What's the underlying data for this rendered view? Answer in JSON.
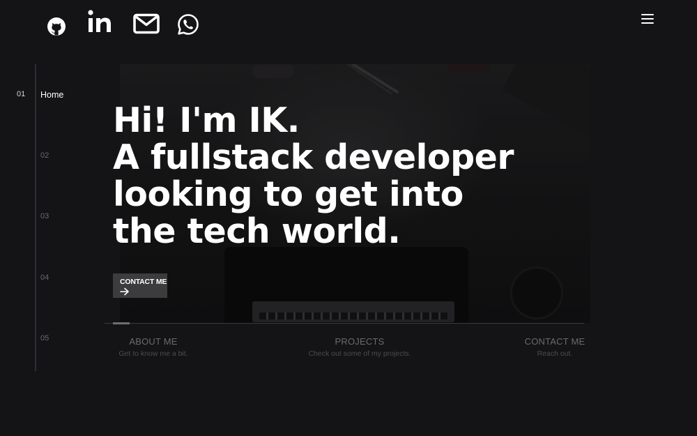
{
  "socials": [
    {
      "name": "github",
      "icon": "github-icon"
    },
    {
      "name": "linkedin",
      "icon": "linkedin-icon",
      "text": "in"
    },
    {
      "name": "email",
      "icon": "mail-icon"
    },
    {
      "name": "whatsapp",
      "icon": "whatsapp-icon"
    }
  ],
  "menu": {
    "icon": "hamburger-menu-icon"
  },
  "side_nav": {
    "items": [
      {
        "number": "01",
        "label": "Home",
        "active": true
      },
      {
        "number": "02",
        "active": false
      },
      {
        "number": "03",
        "active": false
      },
      {
        "number": "04",
        "active": false
      },
      {
        "number": "05",
        "active": false
      }
    ]
  },
  "hero": {
    "lines": [
      "Hi! I'm IK.",
      "A fullstack developer",
      "looking to get into",
      "the tech world."
    ],
    "cta_label": "CONTACT ME",
    "cta_icon": "arrow-right-icon"
  },
  "tabs": [
    {
      "title": "ABOUT ME",
      "subtitle": "Get to know me a bit."
    },
    {
      "title": "PROJECTS",
      "subtitle": "Check out some of my projects."
    },
    {
      "title": "CONTACT ME",
      "subtitle": "Reach out."
    }
  ],
  "colors": {
    "background": "#141416",
    "text": "#ffffff",
    "muted": "#6b6b6f",
    "button": "#3c3c3e"
  }
}
